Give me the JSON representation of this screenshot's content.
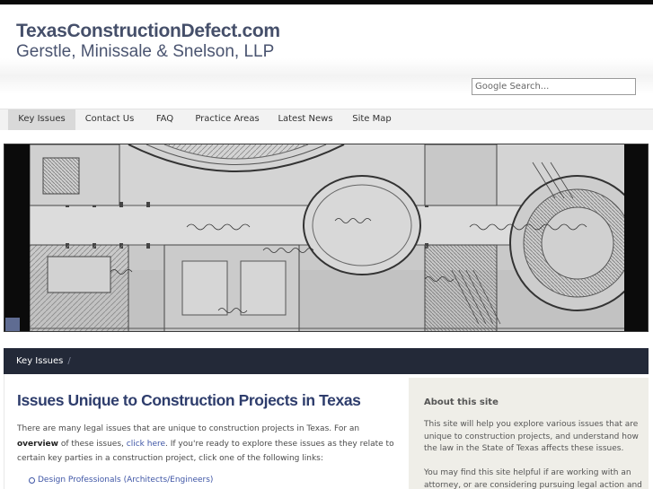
{
  "header": {
    "site_title": "TexasConstructionDefect.com",
    "site_subtitle": "Gerstle, Minissale & Snelson, LLP"
  },
  "search": {
    "placeholder": "Google Search..."
  },
  "nav": {
    "items": [
      {
        "label": "Key Issues",
        "active": true
      },
      {
        "label": "Contact Us"
      },
      {
        "label": "FAQ"
      },
      {
        "label": "Practice Areas"
      },
      {
        "label": "Latest News"
      },
      {
        "label": "Site Map"
      }
    ]
  },
  "hero": {
    "alt": "architectural floor plan drawing"
  },
  "breadcrumb": {
    "current": "Key Issues",
    "separator": "/"
  },
  "content": {
    "title": "Issues Unique to Construction Projects in Texas",
    "intro_part1": "There are many legal issues that are unique to construction projects in Texas. For an ",
    "intro_bold": "overview",
    "intro_part2": " of these issues, ",
    "intro_link": "click here",
    "intro_part3": ". If you're ready to explore these issues as they relate to certain key parties in a construction project, click one of the following links:",
    "links": [
      "Design Professionals (Architects/Engineers)"
    ]
  },
  "sidebar": {
    "title": "About this site",
    "p1": "This site will help you explore various issues that are unique to construction projects, and understand how the law in the State of Texas affects these issues.",
    "p2": "You may find this site helpful if are working with an attorney, or are considering pursuing legal action and"
  },
  "colors": {
    "title_color": "#454f6a",
    "nav_bg": "#f2f2f2",
    "breadbar_bg": "#232938",
    "heading_color": "#2e3d6c",
    "link_color": "#3f56a6",
    "sidebar_bg": "#efeee8"
  }
}
